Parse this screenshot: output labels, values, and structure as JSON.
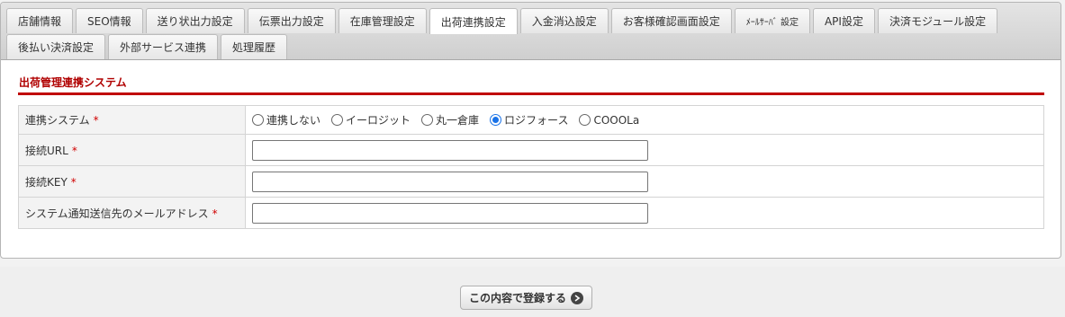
{
  "tabs": {
    "row1": [
      {
        "label": "店舗情報"
      },
      {
        "label": "SEO情報"
      },
      {
        "label": "送り状出力設定"
      },
      {
        "label": "伝票出力設定"
      },
      {
        "label": "在庫管理設定"
      },
      {
        "label": "出荷連携設定",
        "active": true
      },
      {
        "label": "入金消込設定"
      },
      {
        "label": "お客様確認画面設定"
      },
      {
        "label": "ﾒｰﾙｻｰﾊﾞ 設定",
        "small": true
      },
      {
        "label": "API設定"
      },
      {
        "label": "決済モジュール設定"
      }
    ],
    "row2": [
      {
        "label": "後払い決済設定"
      },
      {
        "label": "外部サービス連携"
      },
      {
        "label": "処理履歴"
      }
    ]
  },
  "section": {
    "title": "出荷管理連携システム"
  },
  "form": {
    "required_mark": "*",
    "system": {
      "label": "連携システム",
      "options": [
        "連携しない",
        "イーロジット",
        "丸一倉庫",
        "ロジフォース",
        "COOOLa"
      ],
      "selected": "ロジフォース"
    },
    "url": {
      "label": "接続URL",
      "value": ""
    },
    "key": {
      "label": "接続KEY",
      "value": ""
    },
    "email": {
      "label": "システム通知送信先のメールアドレス",
      "value": ""
    }
  },
  "submit": {
    "label": "この内容で登録する"
  },
  "colors": {
    "accent": "#c00000",
    "radio_checked": "#1a73e8"
  }
}
